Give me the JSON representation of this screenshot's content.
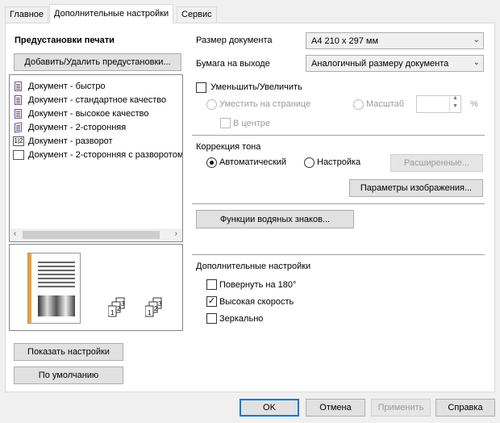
{
  "tabs": [
    {
      "label": "Главное"
    },
    {
      "label": "Дополнительные настройки"
    },
    {
      "label": "Сервис"
    }
  ],
  "presets": {
    "title": "Предустановки печати",
    "add_remove_button": "Добавить/Удалить предустановки...",
    "items": [
      {
        "label": "Документ - быстро",
        "icon": "document-fast-icon"
      },
      {
        "label": "Документ - стандартное качество",
        "icon": "document-standard-icon"
      },
      {
        "label": "Документ - высокое качество",
        "icon": "document-high-quality-icon"
      },
      {
        "label": "Документ - 2-сторонняя",
        "icon": "document-duplex-icon"
      },
      {
        "label": "Документ - разворот",
        "icon": "document-booklet-icon"
      },
      {
        "label": "Документ - 2-сторонняя с разворотом",
        "icon": "document-duplex-booklet-icon"
      }
    ],
    "show_settings_button": "Показать настройки",
    "default_button": "По умолчанию"
  },
  "document_size": {
    "label": "Размер документа",
    "value": "A4 210 x 297 мм"
  },
  "output_paper": {
    "label": "Бумага на выходе",
    "value": "Аналогичный размеру документа"
  },
  "scale": {
    "reduce_enlarge_label": "Уменьшить/Увеличить",
    "fit_page_label": "Уместить на странице",
    "scale_label": "Масштаб",
    "scale_value": "",
    "percent": "%",
    "center_label": "В центре"
  },
  "tone": {
    "title": "Коррекция тона",
    "auto_label": "Автоматический",
    "custom_label": "Настройка",
    "advanced_button": "Расширенные...",
    "image_params_button": "Параметры изображения..."
  },
  "watermark_button": "Функции водяных знаков...",
  "additional": {
    "title": "Дополнительные настройки",
    "rotate_label": "Повернуть на 180°",
    "rotate_checked": false,
    "high_speed_label": "Высокая скорость",
    "high_speed_checked": true,
    "mirror_label": "Зеркально",
    "mirror_checked": false
  },
  "footer": {
    "ok": "OK",
    "cancel": "Отмена",
    "apply": "Применить",
    "help": "Справка"
  },
  "colors": {
    "accent": "#0078d7",
    "preview_bar": "#f0a030"
  }
}
